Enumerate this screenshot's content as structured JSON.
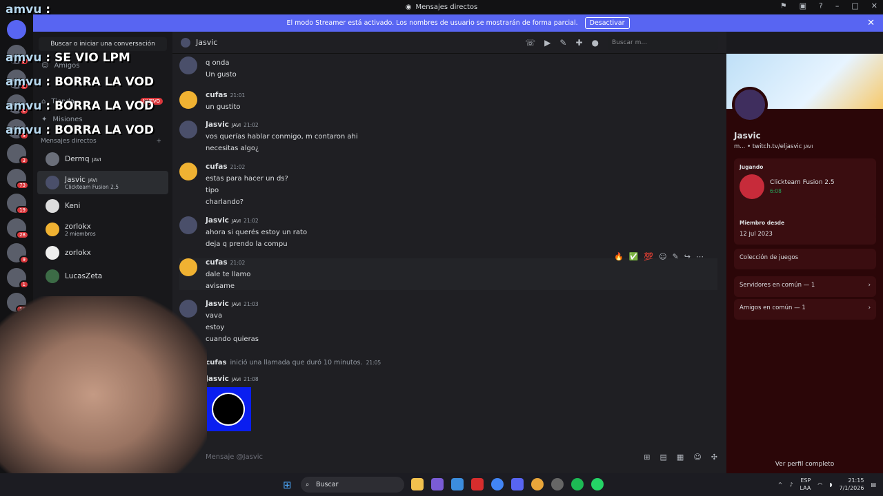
{
  "window": {
    "title": "Mensajes directos"
  },
  "streamer_banner": {
    "text": "El modo Streamer está activado. Los nombres de usuario se mostrarán de forma parcial.",
    "button": "Desactivar"
  },
  "guild_badges": [
    "5",
    "5",
    "1",
    "3",
    "3",
    "73",
    "19",
    "28",
    "9",
    "1",
    "58"
  ],
  "overlay_chat": [
    {
      "user": "amvu",
      "text": "SE VIO LPM"
    },
    {
      "user": "amvu",
      "text": "BORRA LA VOD"
    },
    {
      "user": "amvu",
      "text": "BORRA LA VOD"
    },
    {
      "user": "amvu",
      "text": "BORRA LA VOD"
    }
  ],
  "sidebar": {
    "search_label": "Buscar o iniciar una conversación",
    "nav": [
      {
        "label": "Amigos"
      },
      {
        "label": "Tienda",
        "badge": "NUEVO"
      },
      {
        "label": "Misiones"
      }
    ],
    "dm_header": "Mensajes directos",
    "dms": [
      {
        "name": "Dermq",
        "tag": "JAVI",
        "sub": ""
      },
      {
        "name": "Jasvic",
        "tag": "JAVI",
        "sub": "Clickteam Fusion 2.5"
      },
      {
        "name": "Keni",
        "tag": "",
        "sub": ""
      },
      {
        "name": "zorlokx",
        "tag": "",
        "sub": "2 miembros"
      },
      {
        "name": "zorlokx",
        "tag": "",
        "sub": ""
      },
      {
        "name": "LucasZeta",
        "tag": "",
        "sub": ""
      }
    ]
  },
  "chat": {
    "header_name": "Jasvic",
    "search_placeholder": "Buscar m...",
    "messages": [
      {
        "author": "",
        "time": "",
        "lines": [
          "q onda",
          "Un gusto"
        ]
      },
      {
        "author": "cufas",
        "time": "21:01",
        "lines": [
          "un gustito"
        ]
      },
      {
        "author": "Jasvic",
        "tag": "JAVI",
        "time": "21:02",
        "lines": [
          "vos querías hablar conmigo, m contaron ahi",
          "necesitas algo¿"
        ]
      },
      {
        "author": "cufas",
        "time": "21:02",
        "lines": [
          "estas para hacer un ds?",
          "tipo",
          "charlando?"
        ]
      },
      {
        "author": "Jasvic",
        "tag": "JAVI",
        "time": "21:02",
        "lines": [
          "ahora si querés estoy un rato",
          "deja q prendo la compu"
        ]
      },
      {
        "author": "cufas",
        "time": "21:02",
        "lines": [
          "dale te llamo",
          "avisame"
        ]
      },
      {
        "author": "Jasvic",
        "tag": "JAVI",
        "time": "21:03",
        "lines": [
          "vava",
          "estoy",
          "cuando quieras"
        ]
      },
      {
        "author": "Jasvic",
        "tag": "JAVI",
        "time": "21:08",
        "lines": []
      }
    ],
    "call": {
      "author": "cufas",
      "text": "inició una llamada que duró 10 minutos.",
      "time": "21:05"
    },
    "input_placeholder": "Mensaje @Jasvic"
  },
  "profile": {
    "name": "Jasvic",
    "link": "m... • twitch.tv/eljasvic",
    "tag": "JAVI",
    "playing_label": "Jugando",
    "game": "Clickteam Fusion 2.5",
    "game_time": "6:08",
    "member_since_label": "Miembro desde",
    "member_since": "12 jul 2023",
    "games_collection": "Colección de juegos",
    "mutual_servers": "Servidores en común — 1",
    "mutual_friends": "Amigos en común — 1",
    "view_profile": "Ver perfil completo"
  },
  "taskbar": {
    "search": "Buscar",
    "lang": "ESP",
    "lang2": "LAA",
    "time": "21:15",
    "date": "7/1/2026"
  }
}
